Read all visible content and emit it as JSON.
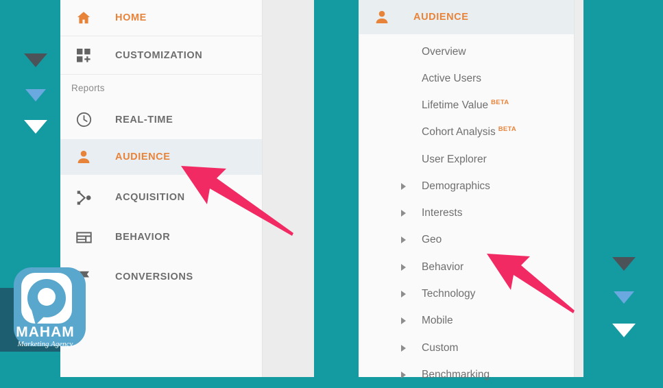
{
  "theme": {
    "background_teal": "#139ba1",
    "panel_background": "#fafafa",
    "active_row_background": "#e8eef1",
    "accent_orange": "#e8833a",
    "label_gray": "#6d6d6d",
    "highlight_pink": "#f22a63",
    "gutter_gray": "#ececec"
  },
  "left_panel": {
    "items": [
      {
        "label": "HOME",
        "icon": "home-icon",
        "state": "accent"
      },
      {
        "label": "CUSTOMIZATION",
        "icon": "customization-icon",
        "state": "normal"
      }
    ],
    "section_label": "Reports",
    "report_items": [
      {
        "label": "REAL-TIME",
        "icon": "clock-icon",
        "state": "normal"
      },
      {
        "label": "AUDIENCE",
        "icon": "person-icon",
        "state": "active"
      },
      {
        "label": "ACQUISITION",
        "icon": "acquisition-icon",
        "state": "normal"
      },
      {
        "label": "BEHAVIOR",
        "icon": "behavior-icon",
        "state": "normal"
      },
      {
        "label": "CONVERSIONS",
        "icon": "flag-icon",
        "state": "normal"
      }
    ]
  },
  "right_panel": {
    "header": {
      "label": "AUDIENCE",
      "icon": "person-icon"
    },
    "items": [
      {
        "label": "Overview",
        "expandable": false,
        "badge": ""
      },
      {
        "label": "Active Users",
        "expandable": false,
        "badge": ""
      },
      {
        "label": "Lifetime Value",
        "expandable": false,
        "badge": "BETA"
      },
      {
        "label": "Cohort Analysis",
        "expandable": false,
        "badge": "BETA"
      },
      {
        "label": "User Explorer",
        "expandable": false,
        "badge": ""
      },
      {
        "label": "Demographics",
        "expandable": true,
        "badge": ""
      },
      {
        "label": "Interests",
        "expandable": true,
        "badge": ""
      },
      {
        "label": "Geo",
        "expandable": true,
        "badge": "",
        "highlighted": true
      },
      {
        "label": "Behavior",
        "expandable": true,
        "badge": ""
      },
      {
        "label": "Technology",
        "expandable": true,
        "badge": ""
      },
      {
        "label": "Mobile",
        "expandable": true,
        "badge": ""
      },
      {
        "label": "Custom",
        "expandable": true,
        "badge": ""
      },
      {
        "label": "Benchmarking",
        "expandable": true,
        "badge": ""
      }
    ]
  },
  "annotations": {
    "arrow_left_target": "AUDIENCE",
    "arrow_right_target": "Geo",
    "arrow_color": "#f22a63"
  },
  "scroll_markers": {
    "left": [
      {
        "name": "triangle-dark",
        "color": "#4c5358"
      },
      {
        "name": "triangle-blue",
        "color": "#6aa9e0"
      },
      {
        "name": "triangle-white",
        "color": "#ffffff"
      }
    ],
    "right": [
      {
        "name": "triangle-dark",
        "color": "#4c5358"
      },
      {
        "name": "triangle-blue",
        "color": "#6aa9e0"
      },
      {
        "name": "triangle-white",
        "color": "#ffffff"
      }
    ]
  },
  "logo": {
    "name": "MAHAM",
    "tagline": "Marketing Agency",
    "mark_color": "#5aa7cd",
    "backdrop_color": "#1d5f70"
  }
}
